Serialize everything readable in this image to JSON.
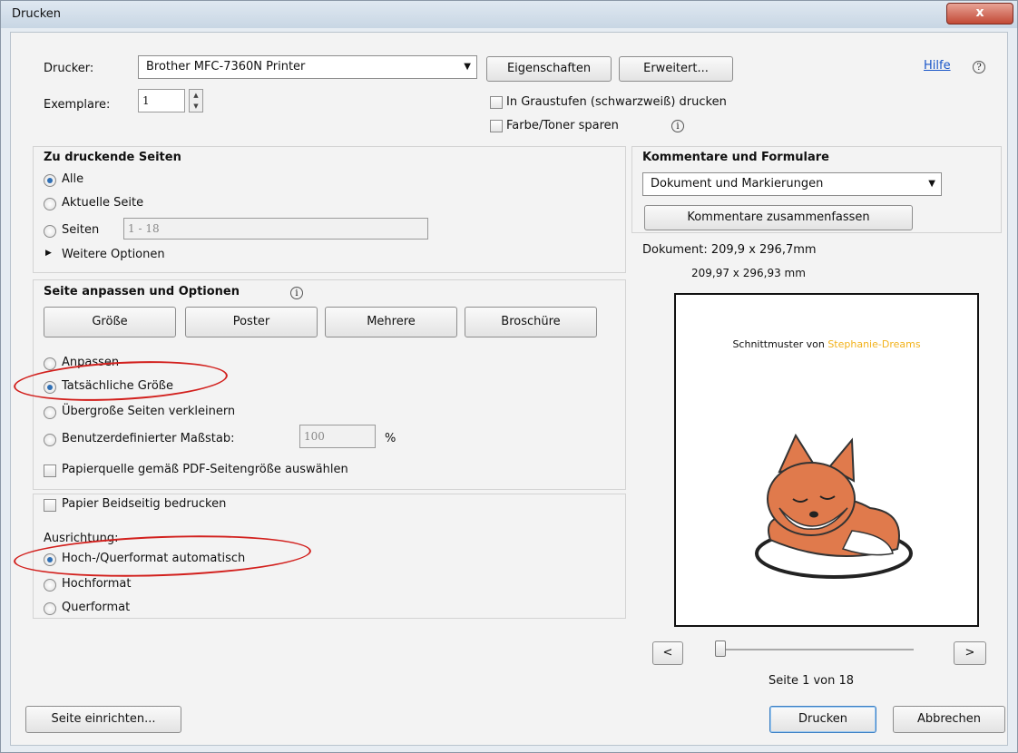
{
  "window": {
    "title": "Drucken",
    "close_glyph": "x"
  },
  "printer": {
    "label": "Drucker:",
    "selected": "Brother MFC-7360N Printer",
    "properties_button": "Eigenschaften",
    "advanced_button": "Erweitert...",
    "help_link": "Hilfe",
    "help_icon": "?"
  },
  "copies": {
    "label": "Exemplare:",
    "value": "1"
  },
  "options": {
    "grayscale": "In Graustufen (schwarzweiß) drucken",
    "save_toner": "Farbe/Toner sparen",
    "info_glyph": "i"
  },
  "pages": {
    "title": "Zu druckende Seiten",
    "all": "Alle",
    "current": "Aktuelle Seite",
    "pages": "Seiten",
    "range_value": "1 - 18",
    "more_options": "Weitere Optionen"
  },
  "fit": {
    "title": "Seite anpassen und Optionen",
    "tabs": [
      "Größe",
      "Poster",
      "Mehrere",
      "Broschüre"
    ],
    "fit": "Anpassen",
    "actual_size": "Tatsächliche Größe",
    "shrink": "Übergroße Seiten verkleinern",
    "custom_scale": "Benutzerdefinierter Maßstab:",
    "scale_value": "100",
    "percent": "%",
    "paper_source": "Papierquelle gemäß PDF-Seitengröße auswählen"
  },
  "duplex": {
    "label": "Papier Beidseitig bedrucken"
  },
  "orientation": {
    "title": "Ausrichtung:",
    "auto": "Hoch-/Querformat automatisch",
    "portrait": "Hochformat",
    "landscape": "Querformat"
  },
  "comments": {
    "title": "Kommentare und Formulare",
    "selected": "Dokument und Markierungen",
    "summarize_button": "Kommentare zusammenfassen"
  },
  "preview": {
    "document_size": "Dokument: 209,9 x 296,7mm",
    "paper_size": "209,97 x 296,93 mm",
    "page_text_prefix": "Schnittmuster von ",
    "page_text_brand": "Stephanie-Dreams",
    "brand_color": "#f2b21b",
    "prev_button": "<",
    "next_button": ">",
    "page_status": "Seite 1 von 18"
  },
  "footer": {
    "page_setup_button": "Seite einrichten...",
    "print_button": "Drucken",
    "cancel_button": "Abbrechen"
  },
  "colors": {
    "annotation_red": "#d2201d",
    "accent": "#2f6fb5"
  }
}
